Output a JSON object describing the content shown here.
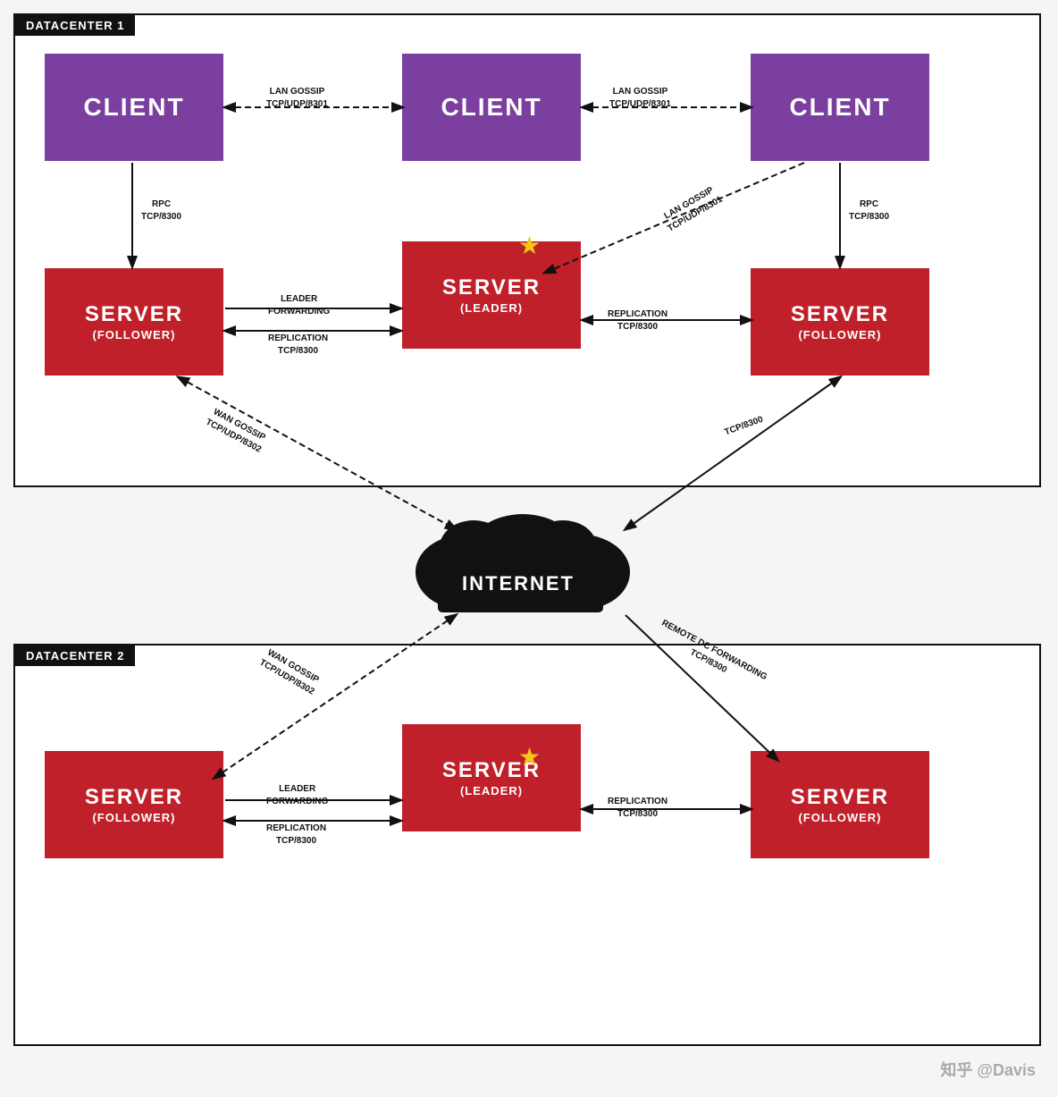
{
  "page": {
    "background": "#f5f5f5"
  },
  "datacenter1": {
    "label": "DATACENTER 1"
  },
  "datacenter2": {
    "label": "DATACENTER 2"
  },
  "clients": [
    {
      "id": "client1",
      "label": "CLIENT"
    },
    {
      "id": "client2",
      "label": "CLIENT"
    },
    {
      "id": "client3",
      "label": "CLIENT"
    }
  ],
  "servers_dc1": [
    {
      "id": "server1-follower",
      "label": "SERVER",
      "sub": "(FOLLOWER)"
    },
    {
      "id": "server1-leader",
      "label": "SERVER",
      "sub": "(LEADER)"
    },
    {
      "id": "server1-follower2",
      "label": "SERVER",
      "sub": "(FOLLOWER)"
    }
  ],
  "servers_dc2": [
    {
      "id": "server2-follower",
      "label": "SERVER",
      "sub": "(FOLLOWER)"
    },
    {
      "id": "server2-leader",
      "label": "SERVER",
      "sub": "(LEADER)"
    },
    {
      "id": "server2-follower2",
      "label": "SERVER",
      "sub": "(FOLLOWER)"
    }
  ],
  "internet_label": "INTERNET",
  "arrows": {
    "lan_gossip_1": {
      "line1": "LAN GOSSIP",
      "line2": "TCP/UDP/8301"
    },
    "lan_gossip_2": {
      "line1": "LAN GOSSIP",
      "line2": "TCP/UDP/8301"
    },
    "lan_gossip_3": {
      "line1": "LAN GOSSIP",
      "line2": "TCP/UDP/8301"
    },
    "rpc_left": {
      "line1": "RPC",
      "line2": "TCP/8300"
    },
    "rpc_right": {
      "line1": "RPC",
      "line2": "TCP/8300"
    },
    "leader_fwd_dc1": {
      "line1": "LEADER",
      "line2": "FORWARDING"
    },
    "replication_dc1_left": {
      "line1": "REPLICATION",
      "line2": "TCP/8300"
    },
    "replication_dc1_right": {
      "line1": "REPLICATION",
      "line2": "TCP/8300"
    },
    "wan_gossip": {
      "line1": "WAN GOSSIP",
      "line2": "TCP/UDP/8302"
    },
    "tcp8300_right": {
      "line1": "TCP/8300"
    },
    "remote_dc_fwd": {
      "line1": "REMOTE DC FORWARDING"
    },
    "tcp8300_dc2": {
      "line1": "TCP/8300"
    },
    "wan_gossip_dc2": {
      "line1": "WAN GOSSIP",
      "line2": "TCP/UDP/8302"
    },
    "leader_fwd_dc2": {
      "line1": "LEADER",
      "line2": "FORWARDING"
    },
    "replication_dc2_left": {
      "line1": "REPLICATION",
      "line2": "TCP/8300"
    },
    "replication_dc2_right": {
      "line1": "REPLICATION",
      "line2": "TCP/8300"
    }
  },
  "watermark": "知乎 @Davis"
}
